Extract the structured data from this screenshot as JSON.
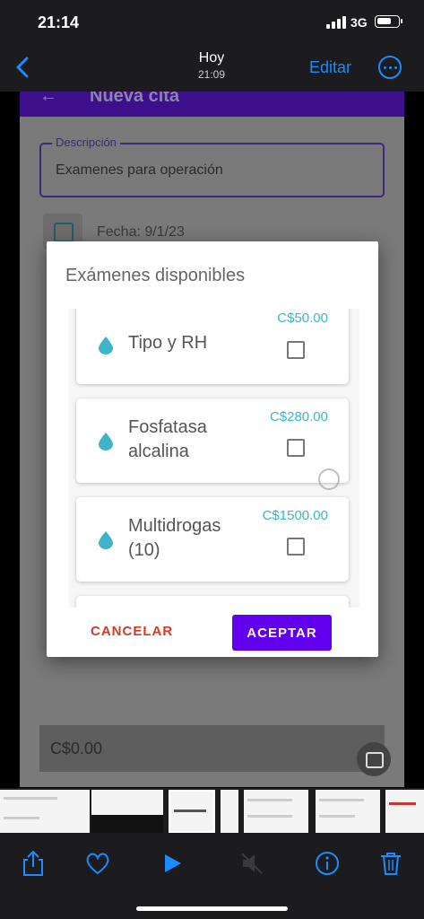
{
  "status_bar": {
    "time": "21:14",
    "network": "3G"
  },
  "nav": {
    "title": "Hoy",
    "subtitle": "21:09",
    "edit_label": "Editar"
  },
  "app": {
    "header_title": "Nueva cita",
    "description": {
      "label": "Descripción",
      "value": "Examenes para operación"
    },
    "date_label": "Fecha: 9/1/23",
    "total": "C$0.00"
  },
  "dialog": {
    "title": "Exámenes disponibles",
    "items": [
      {
        "name": "Tipo y RH",
        "price": "C$50.00",
        "checked": false
      },
      {
        "name": "Fosfatasa alcalina",
        "price": "C$280.00",
        "checked": false
      },
      {
        "name": "Multidrogas (10)",
        "price": "C$1500.00",
        "checked": false
      }
    ],
    "cancel_label": "CANCELAR",
    "accept_label": "ACEPTAR"
  },
  "colors": {
    "accent": "#6200ee",
    "price": "#3fb3c8",
    "cancel": "#d43a24",
    "ios_blue": "#1a8cff"
  }
}
